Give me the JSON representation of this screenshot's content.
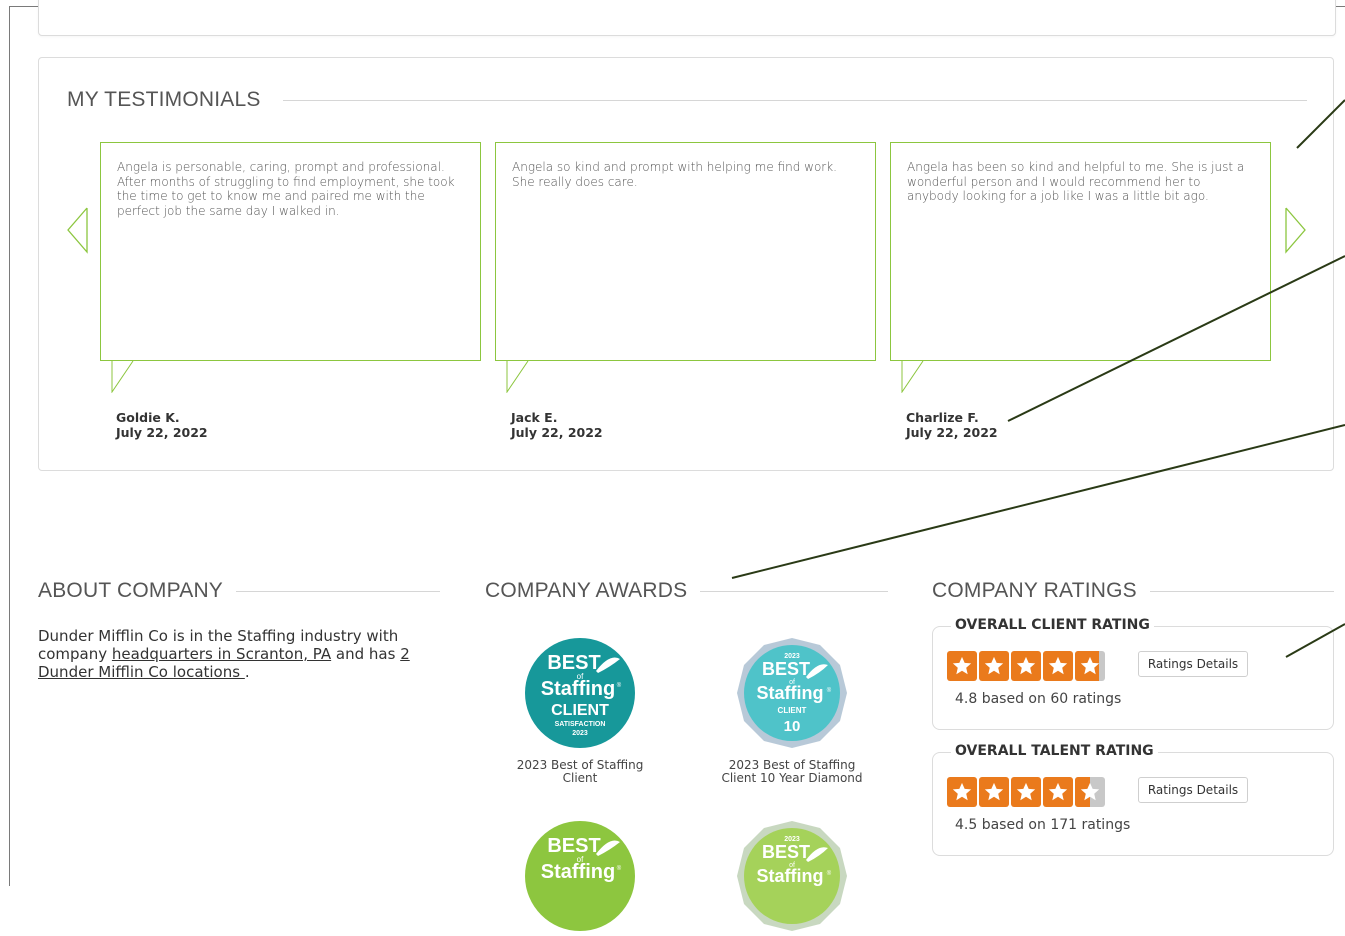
{
  "testimonials": {
    "title": "MY TESTIMONIALS",
    "items": [
      {
        "text": "Angela is personable, caring, prompt and professional. After months of struggling to find employment, she took the time to get to know me and paired me with the perfect job the same day I walked in.",
        "author": "Goldie K.",
        "date": "July 22, 2022"
      },
      {
        "text": "Angela so kind and prompt with helping me find work. She really does care.",
        "author": "Jack E.",
        "date": "July 22, 2022"
      },
      {
        "text": "Angela has been so kind and helpful to me. She is just a wonderful person and I would recommend her to anybody looking for a job like I was a little bit ago.",
        "author": "Charlize F.",
        "date": "July 22, 2022"
      }
    ]
  },
  "about": {
    "title": "ABOUT COMPANY",
    "text_pre": "Dunder Mifflin Co is in the Staffing industry with company ",
    "hq_link": "headquarters in Scranton, PA",
    "text_mid": " and has ",
    "locations_link": "2 Dunder Mifflin Co locations ",
    "text_post": "."
  },
  "awards": {
    "title": "COMPANY AWARDS",
    "items": [
      {
        "caption": "2023 Best of Staffing Client",
        "badge_top": "BEST",
        "badge_of": "of",
        "badge_mid": "Staffing",
        "badge_reg": "®",
        "badge_sub": "CLIENT",
        "badge_sub2": "SATISFACTION",
        "badge_year": "2023",
        "color": "#17989a"
      },
      {
        "caption": "2023 Best of Staffing Client 10 Year Diamond",
        "badge_top": "BEST",
        "badge_of": "of",
        "badge_mid": "Staffing",
        "badge_reg": "®",
        "badge_sub": "CLIENT",
        "badge_year": "2023",
        "badge_num": "10",
        "color": "#4fc3c9"
      },
      {
        "badge_top": "BEST",
        "badge_of": "of",
        "badge_mid": "Staffing",
        "badge_reg": "®",
        "color": "#8dc63f"
      },
      {
        "badge_top": "BEST",
        "badge_of": "of",
        "badge_mid": "Staffing",
        "badge_reg": "®",
        "badge_year": "2023",
        "color": "#a5d25a"
      }
    ]
  },
  "ratings": {
    "title": "COMPANY RATINGS",
    "client": {
      "label": "OVERALL CLIENT RATING",
      "value": 4.8,
      "summary": "4.8 based on 60 ratings",
      "button": "Ratings Details"
    },
    "talent": {
      "label": "OVERALL TALENT RATING",
      "value": 4.5,
      "summary": "4.5 based on 171 ratings",
      "button": "Ratings Details"
    }
  },
  "colors": {
    "accent_green": "#8cc63f",
    "star_orange": "#ea7a1c",
    "annotation": "#2a3a16"
  }
}
